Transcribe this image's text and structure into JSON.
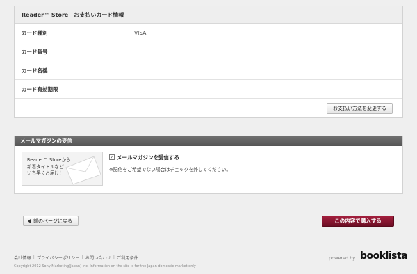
{
  "card_panel": {
    "title": "Reader™ Store　お支払いカード情報",
    "rows": [
      {
        "label": "カード種別",
        "value": "VISA"
      },
      {
        "label": "カード番号",
        "value": ""
      },
      {
        "label": "カード名義",
        "value": ""
      },
      {
        "label": "カード有効期限",
        "value": ""
      }
    ],
    "change_button": "お支払い方法を変更する"
  },
  "mail_panel": {
    "title": "メールマガジンの受信",
    "promo_text": "Reader™ Storeから\n新着タイトルなど\nいち早くお届け！",
    "checkbox_checked": true,
    "checkbox_mark": "✓",
    "checkbox_label": "メールマガジンを受信する",
    "note": "※配信をご希望でない場合はチェックを外してください。"
  },
  "actions": {
    "back_label": "前のページに戻る",
    "buy_label": "この内容で購入する"
  },
  "footer": {
    "links": [
      "会社情報",
      "プライバシーポリシー",
      "お問い合わせ",
      "ご利用条件"
    ],
    "separator": "|",
    "copyright": "Copyright 2012 Sony Marketing(Japan) Inc.  Information on the site is for the Japan domestic market only",
    "powered_by": "powered by",
    "logo_text": "booklista"
  },
  "colors": {
    "buy_button": "#8a1530",
    "section_header_dark": "#606060"
  }
}
